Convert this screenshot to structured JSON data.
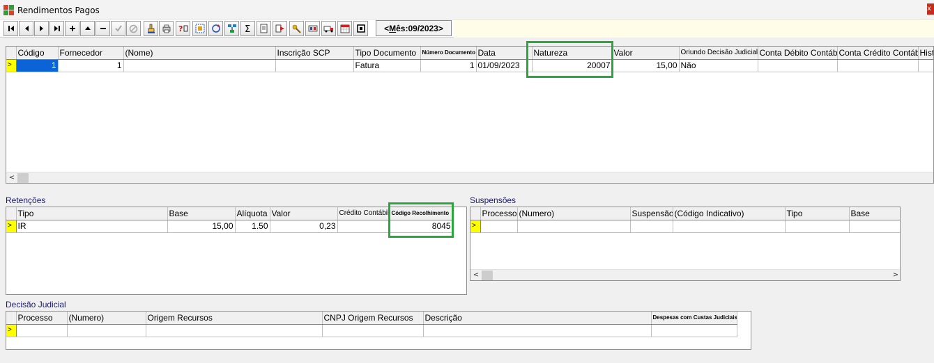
{
  "window": {
    "title": "Rendimentos Pagos",
    "close_label": "x"
  },
  "toolbar": {
    "month_prefix": "<",
    "month_mnemonic": "M",
    "month_rest": "ês:09/2023",
    "month_suffix": ">"
  },
  "main_grid": {
    "columns": [
      "Código",
      "Fornecedor",
      "(Nome)",
      "Inscrição SCP",
      "Tipo Documento",
      "Número Documento",
      "Data",
      "Natureza",
      "Valor",
      "Oriundo Decisão Judicial",
      "Conta Débito Contábil",
      "Conta Crédito Contábil",
      "Histó"
    ],
    "row": {
      "codigo": "1",
      "fornecedor": "1",
      "nome": "",
      "inscricao_scp": "",
      "tipo_documento": "Fatura",
      "numero_documento": "1",
      "data": "01/09/2023",
      "natureza": "20007",
      "valor": "15,00",
      "oriundo": "Não",
      "conta_debito": "",
      "conta_credito": "",
      "historico": ""
    }
  },
  "retencoes": {
    "label": "Retenções",
    "columns": [
      "Tipo",
      "Base",
      "Alíquota",
      "Valor",
      "Crédito Contábil",
      "Código Recolhimento"
    ],
    "row": {
      "tipo": "IR",
      "base": "15,00",
      "aliquota": "1.50",
      "valor": "0,23",
      "credito": "",
      "codigo_recolhimento": "8045"
    }
  },
  "suspensoes": {
    "label": "Suspensões",
    "columns": [
      "Processo",
      "(Numero)",
      "Suspensão",
      "(Código Indicativo)",
      "Tipo",
      "Base"
    ]
  },
  "decisao": {
    "label": "Decisão Judicial",
    "columns": [
      "Processo",
      "(Numero)",
      "Origem Recursos",
      "CNPJ Origem Recursos",
      "Descrição",
      "Despesas com Custas Judiciais"
    ]
  },
  "scroll": {
    "left_arrow": "<",
    "right_arrow": ">"
  },
  "colors": {
    "highlight": "#2aa63c",
    "selection": "#0a64d8",
    "indicator": "#ffff00"
  }
}
